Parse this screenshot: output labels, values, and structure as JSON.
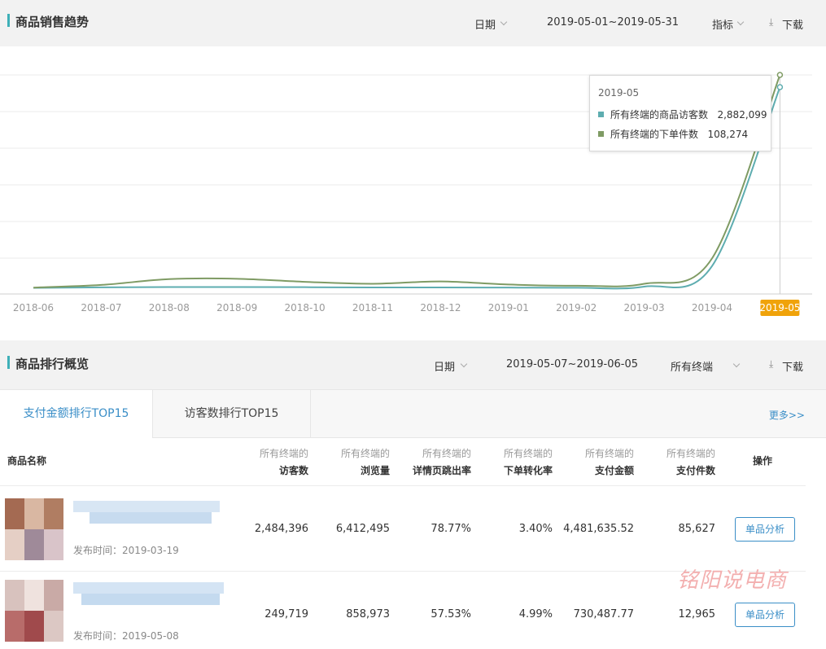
{
  "colors": {
    "accent": "#3eb0b8",
    "link": "#3a8ec7",
    "visitors_line": "#5eadb0",
    "orders_line": "#7f9b64",
    "highlight": "#f0a30a"
  },
  "trend": {
    "title": "商品销售趋势",
    "date_label": "日期",
    "date_range": "2019-05-01~2019-05-31",
    "metric_label": "指标",
    "download_label": "下载"
  },
  "chart_data": {
    "type": "line",
    "x": [
      "2018-06",
      "2018-07",
      "2018-08",
      "2018-09",
      "2018-10",
      "2018-11",
      "2018-12",
      "2019-01",
      "2019-02",
      "2019-03",
      "2019-04",
      "2019-05"
    ],
    "highlighted_x": "2019-05",
    "series": [
      {
        "name": "所有终端的商品访客数",
        "values": [
          40000,
          48000,
          52000,
          52000,
          50000,
          46000,
          46000,
          44000,
          42000,
          58000,
          350000,
          2882099
        ]
      },
      {
        "name": "所有终端的下单件数",
        "values": [
          40,
          75,
          150,
          155,
          115,
          90,
          120,
          80,
          65,
          90,
          420,
          2800
        ]
      }
    ],
    "grid": true
  },
  "tooltip": {
    "date": "2019-05",
    "rows": [
      {
        "label": "所有终端的商品访客数",
        "value": "2,882,099"
      },
      {
        "label": "所有终端的下单件数",
        "value": "108,274"
      }
    ]
  },
  "ranking": {
    "title": "商品排行概览",
    "date_label": "日期",
    "date_range": "2019-05-07~2019-06-05",
    "terminal_label": "所有终端",
    "download_label": "下载",
    "tabs": [
      "支付金额排行TOP15",
      "访客数排行TOP15"
    ],
    "more": "更多>>",
    "columns": {
      "name": "商品名称",
      "prefix": "所有终端的",
      "visitors": "访客数",
      "views": "浏览量",
      "bounce": "详情页跳出率",
      "conversion": "下单转化率",
      "amount": "支付金额",
      "quantity": "支付件数",
      "action": "操作"
    },
    "rows": [
      {
        "published": "发布时间：2019-03-19",
        "visitors": "2,484,396",
        "views": "6,412,495",
        "bounce": "78.77%",
        "conversion": "3.40%",
        "amount": "4,481,635.52",
        "quantity": "85,627",
        "action": "单品分析"
      },
      {
        "published": "发布时间：2019-05-08",
        "visitors": "249,719",
        "views": "858,973",
        "bounce": "57.53%",
        "conversion": "4.99%",
        "amount": "730,487.77",
        "quantity": "12,965",
        "action": "单品分析"
      }
    ]
  },
  "watermark": "铭阳说电商"
}
